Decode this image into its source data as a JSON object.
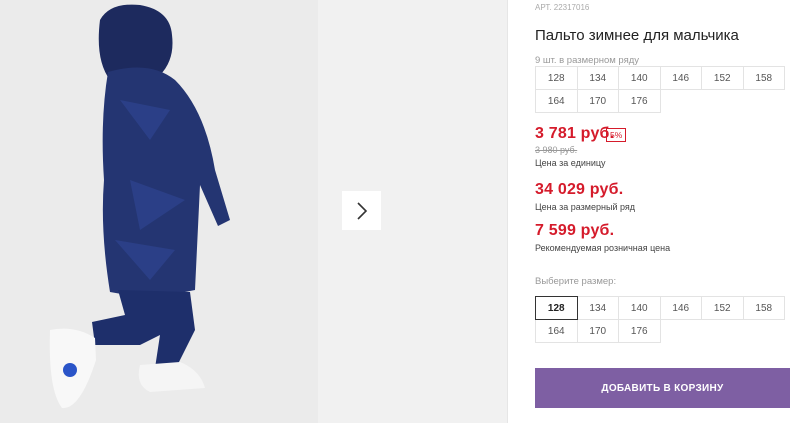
{
  "gallery": {
    "next_icon": "chevron-right-icon"
  },
  "product": {
    "article": "АРТ. 22317016",
    "title": "Пальто зимнее для мальчика",
    "pack_note": "9 шт. в размерном ряду"
  },
  "size_row_sizes": [
    [
      "128",
      "134",
      "140",
      "146",
      "152",
      "158"
    ],
    [
      "164",
      "170",
      "176"
    ]
  ],
  "prices": {
    "unit_price": "3 781 руб.",
    "discount": "5%",
    "old_price": "3 980 руб.",
    "unit_caption": "Цена за единицу",
    "set_price": "34 029 руб.",
    "set_caption": "Цена за размерный ряд",
    "retail_price": "7 599 руб.",
    "retail_caption": "Рекомендуемая розничная цена"
  },
  "size_select": {
    "label": "Выберите размер:",
    "selected": "128",
    "sizes": [
      [
        "128",
        "134",
        "140",
        "146",
        "152",
        "158"
      ],
      [
        "164",
        "170",
        "176"
      ]
    ]
  },
  "cart": {
    "label": "ДОБАВИТЬ В КОРЗИНУ"
  },
  "colors": {
    "accent": "#7e5fa3",
    "price": "#d51b2b"
  }
}
